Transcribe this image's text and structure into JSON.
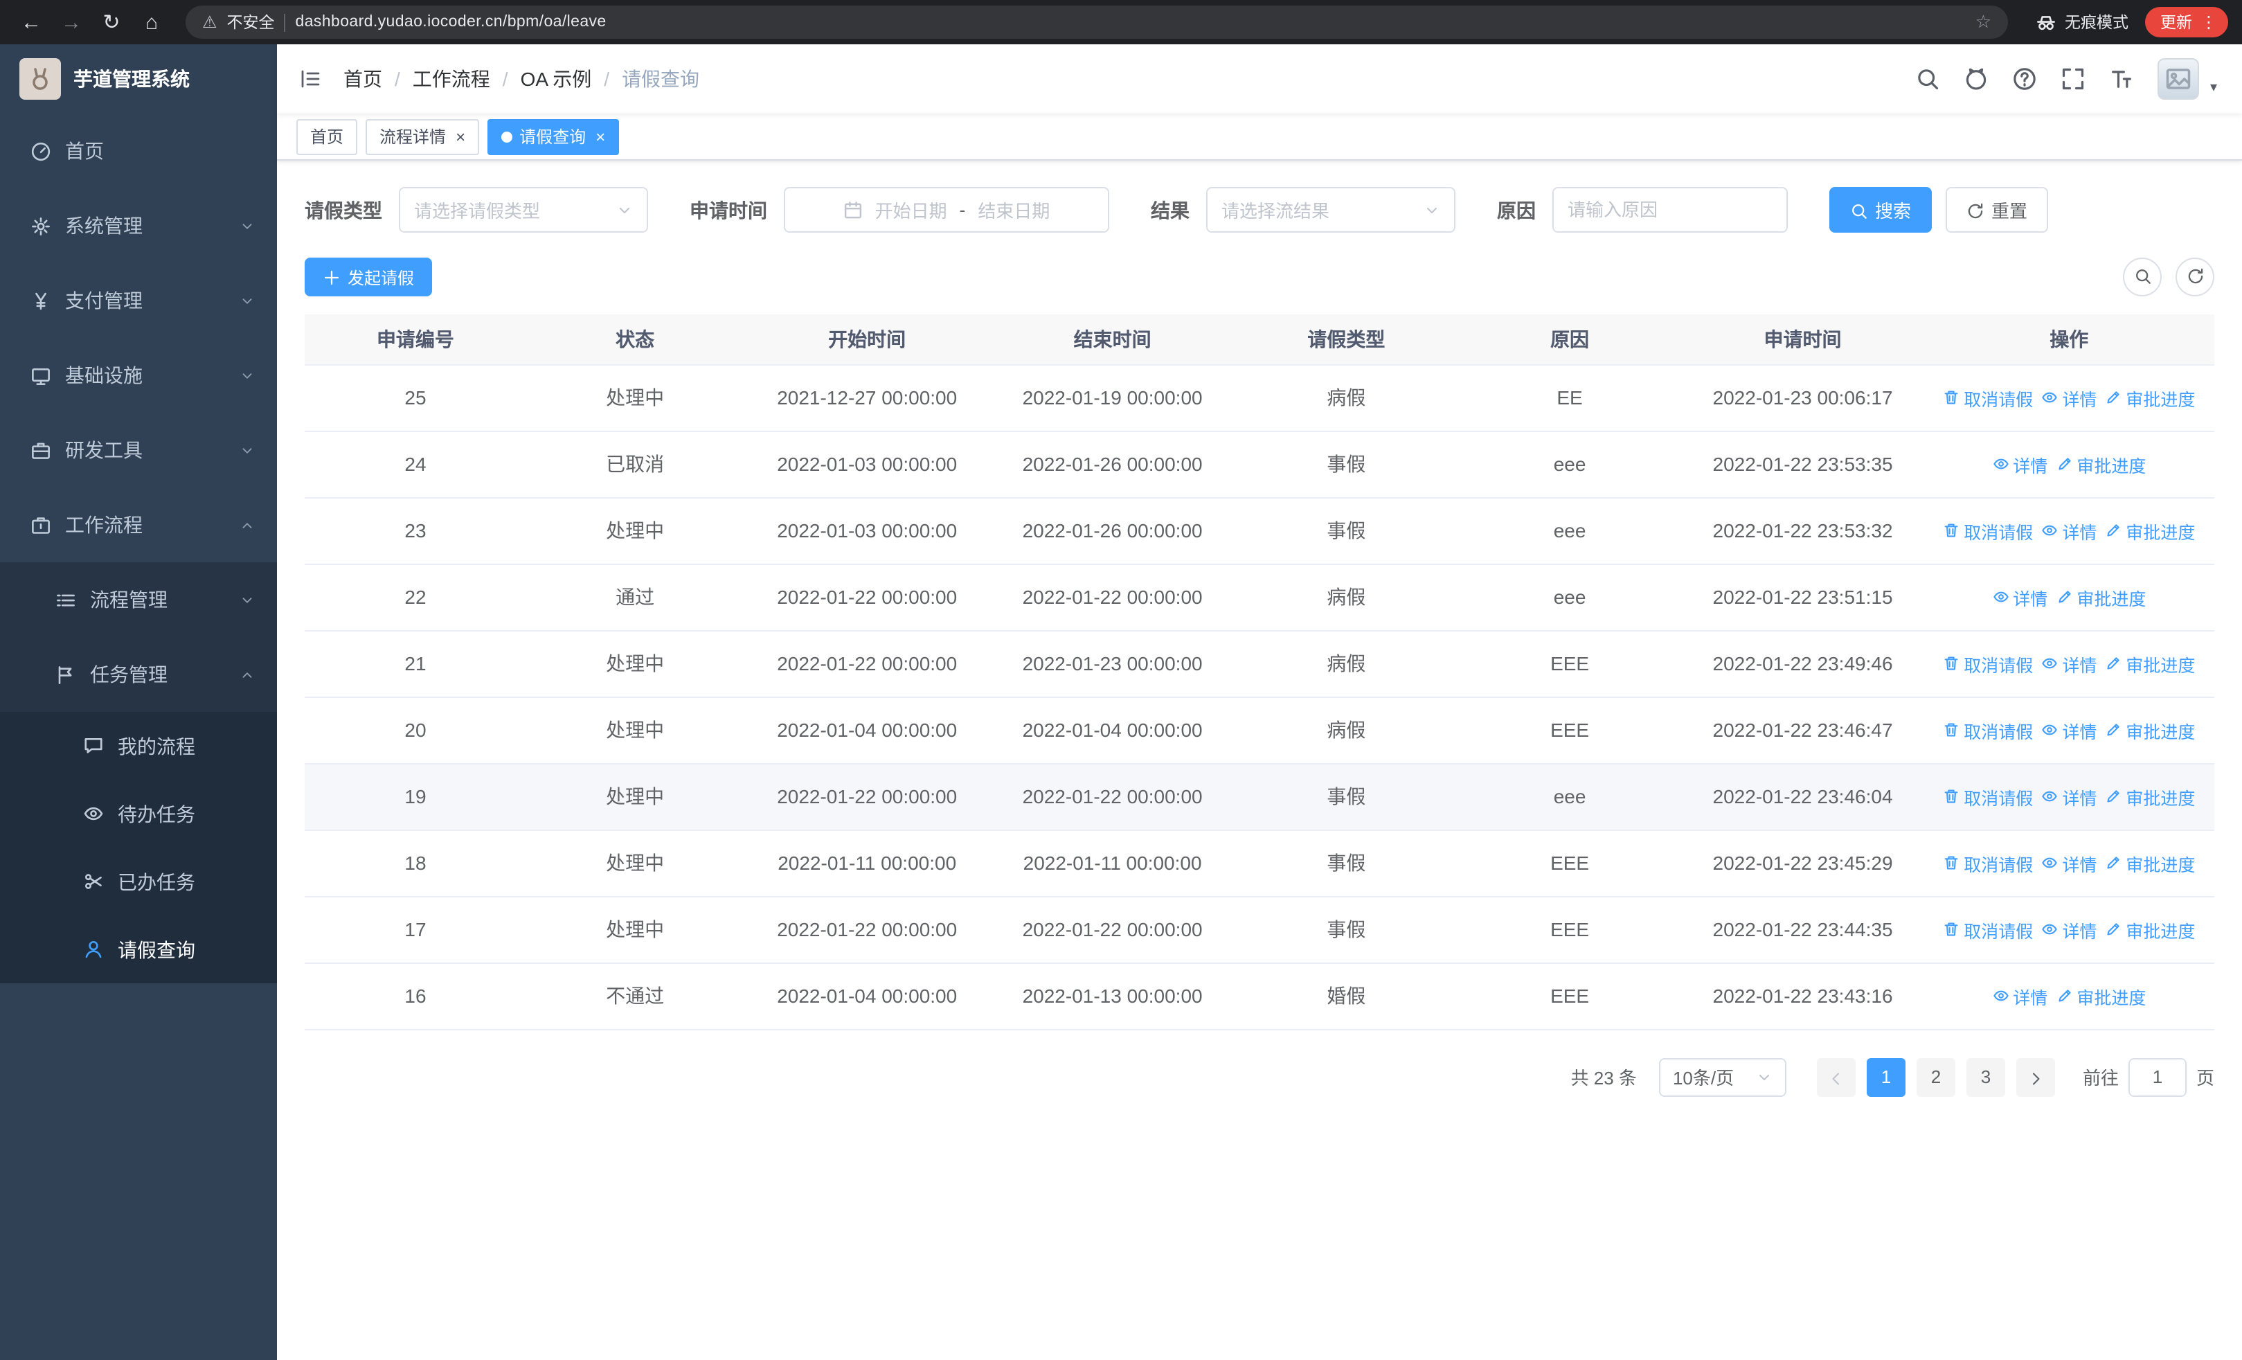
{
  "colors": {
    "accent": "#409eff",
    "sidebar_bg": "#304156",
    "update_red": "#e8453c"
  },
  "icons": {
    "back": "←",
    "forward": "→",
    "reload": "↻",
    "home": "⌂",
    "warning": "⚠",
    "star": "☆",
    "menu_dots": "⋮",
    "close": "×",
    "caret_down": "▾"
  },
  "browser": {
    "security_warning": "不安全",
    "url": "dashboard.yudao.iocoder.cn/bpm/oa/leave",
    "incognito_label": "无痕模式",
    "update_label": "更新"
  },
  "sidebar": {
    "logo_title": "芋道管理系统",
    "menu": [
      {
        "label": "首页",
        "icon": "gauge",
        "level": 0
      },
      {
        "label": "系统管理",
        "icon": "gear",
        "level": 0,
        "chevron": "down"
      },
      {
        "label": "支付管理",
        "icon": "yen",
        "level": 0,
        "chevron": "down"
      },
      {
        "label": "基础设施",
        "icon": "board",
        "level": 0,
        "chevron": "down"
      },
      {
        "label": "研发工具",
        "icon": "briefcase",
        "level": 0,
        "chevron": "down"
      },
      {
        "label": "工作流程",
        "icon": "suitcase",
        "level": 0,
        "chevron": "up"
      },
      {
        "label": "流程管理",
        "icon": "list",
        "level": 1,
        "chevron": "down"
      },
      {
        "label": "任务管理",
        "icon": "flag",
        "level": 1,
        "chevron": "up"
      },
      {
        "label": "我的流程",
        "icon": "chat",
        "level": 2
      },
      {
        "label": "待办任务",
        "icon": "eye",
        "level": 2
      },
      {
        "label": "已办任务",
        "icon": "scissors",
        "level": 2
      },
      {
        "label": "请假查询",
        "icon": "user",
        "level": 2,
        "active": true
      }
    ]
  },
  "header": {
    "breadcrumb": [
      "首页",
      "工作流程",
      "OA 示例",
      "请假查询"
    ],
    "action_icons": [
      "search-icon",
      "github-icon",
      "question-icon",
      "fullscreen-icon",
      "font-size-icon",
      "avatar",
      "caret-down-icon"
    ]
  },
  "tabs": [
    {
      "label": "首页",
      "closable": false,
      "active": false
    },
    {
      "label": "流程详情",
      "closable": true,
      "active": false
    },
    {
      "label": "请假查询",
      "closable": true,
      "active": true
    }
  ],
  "filters": {
    "leave_type_label": "请假类型",
    "leave_type_placeholder": "请选择请假类型",
    "apply_time_label": "申请时间",
    "start_date_placeholder": "开始日期",
    "range_separator": "-",
    "end_date_placeholder": "结束日期",
    "result_label": "结果",
    "result_placeholder": "请选择流结果",
    "reason_label": "原因",
    "reason_placeholder": "请输入原因",
    "search_button": "搜索",
    "reset_button": "重置"
  },
  "toolbar": {
    "create_button": "发起请假"
  },
  "table": {
    "columns": [
      "申请编号",
      "状态",
      "开始时间",
      "结束时间",
      "请假类型",
      "原因",
      "申请时间",
      "操作"
    ],
    "actions": {
      "cancel": "取消请假",
      "detail": "详情",
      "progress": "审批进度"
    },
    "rows": [
      {
        "id": "25",
        "status": "处理中",
        "start_time": "2021-12-27 00:00:00",
        "end_time": "2022-01-19 00:00:00",
        "leave_type": "病假",
        "reason": "EE",
        "apply_time": "2022-01-23 00:06:17",
        "cancellable": true,
        "hovered": false
      },
      {
        "id": "24",
        "status": "已取消",
        "start_time": "2022-01-03 00:00:00",
        "end_time": "2022-01-26 00:00:00",
        "leave_type": "事假",
        "reason": "eee",
        "apply_time": "2022-01-22 23:53:35",
        "cancellable": false,
        "hovered": false
      },
      {
        "id": "23",
        "status": "处理中",
        "start_time": "2022-01-03 00:00:00",
        "end_time": "2022-01-26 00:00:00",
        "leave_type": "事假",
        "reason": "eee",
        "apply_time": "2022-01-22 23:53:32",
        "cancellable": true,
        "hovered": false
      },
      {
        "id": "22",
        "status": "通过",
        "start_time": "2022-01-22 00:00:00",
        "end_time": "2022-01-22 00:00:00",
        "leave_type": "病假",
        "reason": "eee",
        "apply_time": "2022-01-22 23:51:15",
        "cancellable": false,
        "hovered": false
      },
      {
        "id": "21",
        "status": "处理中",
        "start_time": "2022-01-22 00:00:00",
        "end_time": "2022-01-23 00:00:00",
        "leave_type": "病假",
        "reason": "EEE",
        "apply_time": "2022-01-22 23:49:46",
        "cancellable": true,
        "hovered": false
      },
      {
        "id": "20",
        "status": "处理中",
        "start_time": "2022-01-04 00:00:00",
        "end_time": "2022-01-04 00:00:00",
        "leave_type": "病假",
        "reason": "EEE",
        "apply_time": "2022-01-22 23:46:47",
        "cancellable": true,
        "hovered": false
      },
      {
        "id": "19",
        "status": "处理中",
        "start_time": "2022-01-22 00:00:00",
        "end_time": "2022-01-22 00:00:00",
        "leave_type": "事假",
        "reason": "eee",
        "apply_time": "2022-01-22 23:46:04",
        "cancellable": true,
        "hovered": true
      },
      {
        "id": "18",
        "status": "处理中",
        "start_time": "2022-01-11 00:00:00",
        "end_time": "2022-01-11 00:00:00",
        "leave_type": "事假",
        "reason": "EEE",
        "apply_time": "2022-01-22 23:45:29",
        "cancellable": true,
        "hovered": false
      },
      {
        "id": "17",
        "status": "处理中",
        "start_time": "2022-01-22 00:00:00",
        "end_time": "2022-01-22 00:00:00",
        "leave_type": "事假",
        "reason": "EEE",
        "apply_time": "2022-01-22 23:44:35",
        "cancellable": true,
        "hovered": false
      },
      {
        "id": "16",
        "status": "不通过",
        "start_time": "2022-01-04 00:00:00",
        "end_time": "2022-01-13 00:00:00",
        "leave_type": "婚假",
        "reason": "EEE",
        "apply_time": "2022-01-22 23:43:16",
        "cancellable": false,
        "hovered": false
      }
    ]
  },
  "pagination": {
    "total": "共 23 条",
    "page_size": "10条/页",
    "pages": [
      "1",
      "2",
      "3"
    ],
    "active_page": "1",
    "goto_prefix": "前往",
    "goto_value": "1",
    "goto_suffix": "页"
  }
}
